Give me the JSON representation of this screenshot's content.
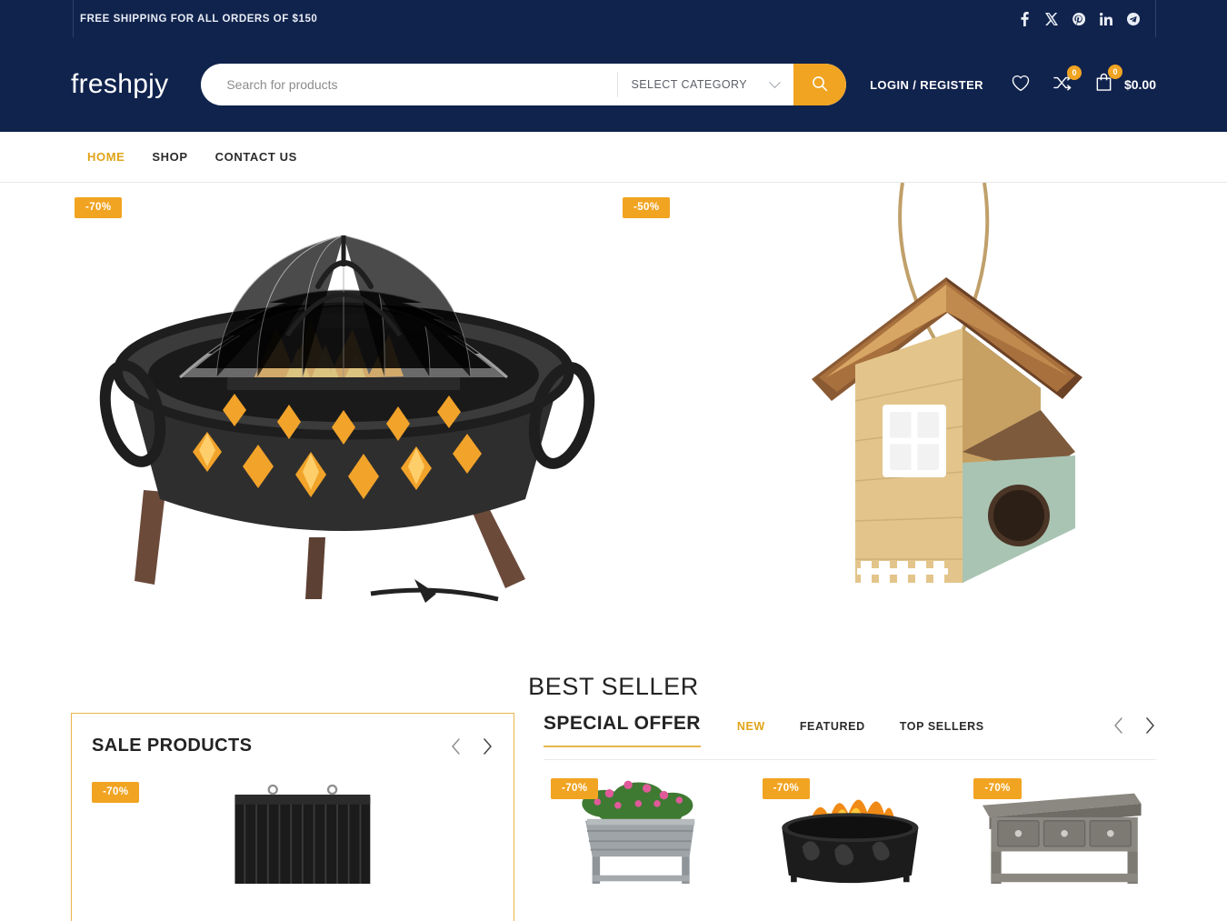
{
  "topbar": {
    "message": "FREE SHIPPING FOR ALL ORDERS OF $150",
    "socials": [
      {
        "name": "facebook-icon",
        "label": "Facebook"
      },
      {
        "name": "x-twitter-icon",
        "label": "X"
      },
      {
        "name": "pinterest-icon",
        "label": "Pinterest"
      },
      {
        "name": "linkedin-icon",
        "label": "LinkedIn"
      },
      {
        "name": "telegram-icon",
        "label": "Telegram"
      }
    ]
  },
  "header": {
    "logo": "freshpjy",
    "search": {
      "placeholder": "Search for products",
      "value": "",
      "category_label": "SELECT CATEGORY",
      "button_icon": "search-icon"
    },
    "login_label": "LOGIN / REGISTER",
    "wishlist_icon": "heart-icon",
    "compare_icon": "compare-icon",
    "compare_count": "0",
    "cart_icon": "shopping-bag-icon",
    "cart_count": "0",
    "cart_total": "$0.00"
  },
  "nav": {
    "items": [
      {
        "label": "HOME",
        "active": true
      },
      {
        "label": "SHOP",
        "active": false
      },
      {
        "label": "CONTACT US",
        "active": false
      }
    ]
  },
  "hero": {
    "banners": [
      {
        "name": "fire-pit-banner",
        "discount": "-70%",
        "alt": "Outdoor fire pit with mesh dome cover"
      },
      {
        "name": "bird-house-banner",
        "discount": "-50%",
        "alt": "Hanging wooden bird house"
      }
    ]
  },
  "best_seller": {
    "title": "BEST SELLER"
  },
  "sale_products": {
    "title": "SALE PRODUCTS",
    "prev_icon": "chevron-left-icon",
    "next_icon": "chevron-right-icon",
    "items": [
      {
        "discount": "-70%",
        "alt": "Black corrugated water tank"
      }
    ]
  },
  "special_offer": {
    "title": "SPECIAL OFFER",
    "tabs": [
      {
        "label": "NEW",
        "active": true
      },
      {
        "label": "FEATURED",
        "active": false
      },
      {
        "label": "TOP SELLERS",
        "active": false
      }
    ],
    "prev_icon": "chevron-left-icon",
    "next_icon": "chevron-right-icon",
    "items": [
      {
        "discount": "-70%",
        "alt": "Grey raised planter box with flowers"
      },
      {
        "discount": "-70%",
        "alt": "Round fire pit with flames"
      },
      {
        "discount": "-70%",
        "alt": "Grey console table with three drawers"
      }
    ]
  },
  "colors": {
    "navy": "#10234d",
    "accent_orange": "#f1a422",
    "accent_gold": "#e0a419",
    "border_gold": "#e7b64a",
    "text_dark": "#232323"
  }
}
